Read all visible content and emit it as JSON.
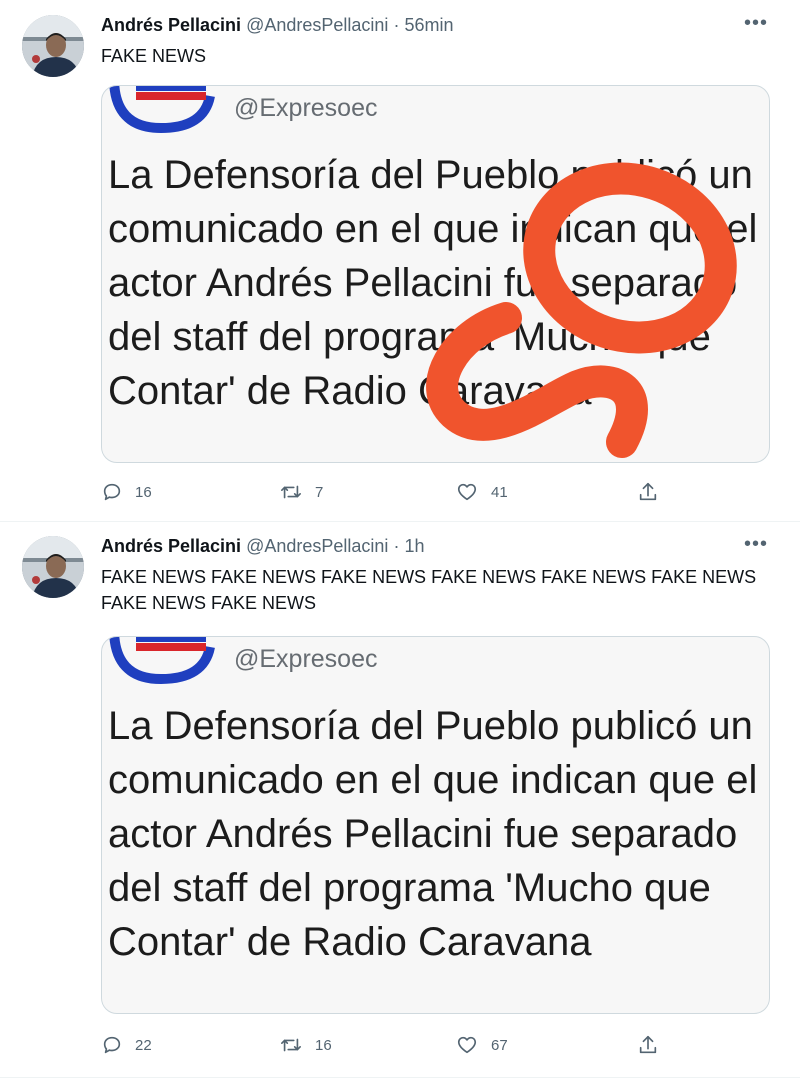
{
  "tweets": [
    {
      "author_name": "Andrés Pellacini",
      "author_handle": "@AndresPellacini",
      "separator": "·",
      "time": "56min",
      "text": "FAKE NEWS",
      "media": {
        "handle": "@Expresoec",
        "body": "La Defensoría del Pueblo publicó un comunicado en el que indican que el actor Andrés Pellacini fue separado del staff del programa 'Mucho que Contar' de Radio Caravana",
        "overlay": "red-scribble"
      },
      "actions": {
        "replies": "16",
        "retweets": "7",
        "likes": "41"
      }
    },
    {
      "author_name": "Andrés Pellacini",
      "author_handle": "@AndresPellacini",
      "separator": "·",
      "time": "1h",
      "text": "FAKE NEWS FAKE NEWS FAKE NEWS FAKE NEWS FAKE NEWS FAKE NEWS FAKE NEWS FAKE NEWS",
      "media": {
        "handle": "@Expresoec",
        "body": "La Defensoría del Pueblo publicó un comunicado en el que indican que el actor Andrés Pellacini fue separado del staff del programa 'Mucho que Contar' de Radio Caravana"
      },
      "actions": {
        "replies": "22",
        "retweets": "16",
        "likes": "67"
      }
    }
  ],
  "icons": {
    "more": "more-horizontal-icon",
    "reply": "reply-icon",
    "retweet": "retweet-icon",
    "like": "heart-icon",
    "share": "share-icon"
  },
  "colors": {
    "text": "#0f1419",
    "secondary": "#536471",
    "divider": "#eff3f4",
    "scribble": "#f0542d",
    "logo_blue": "#1f3fbf",
    "logo_red": "#d9262b"
  }
}
